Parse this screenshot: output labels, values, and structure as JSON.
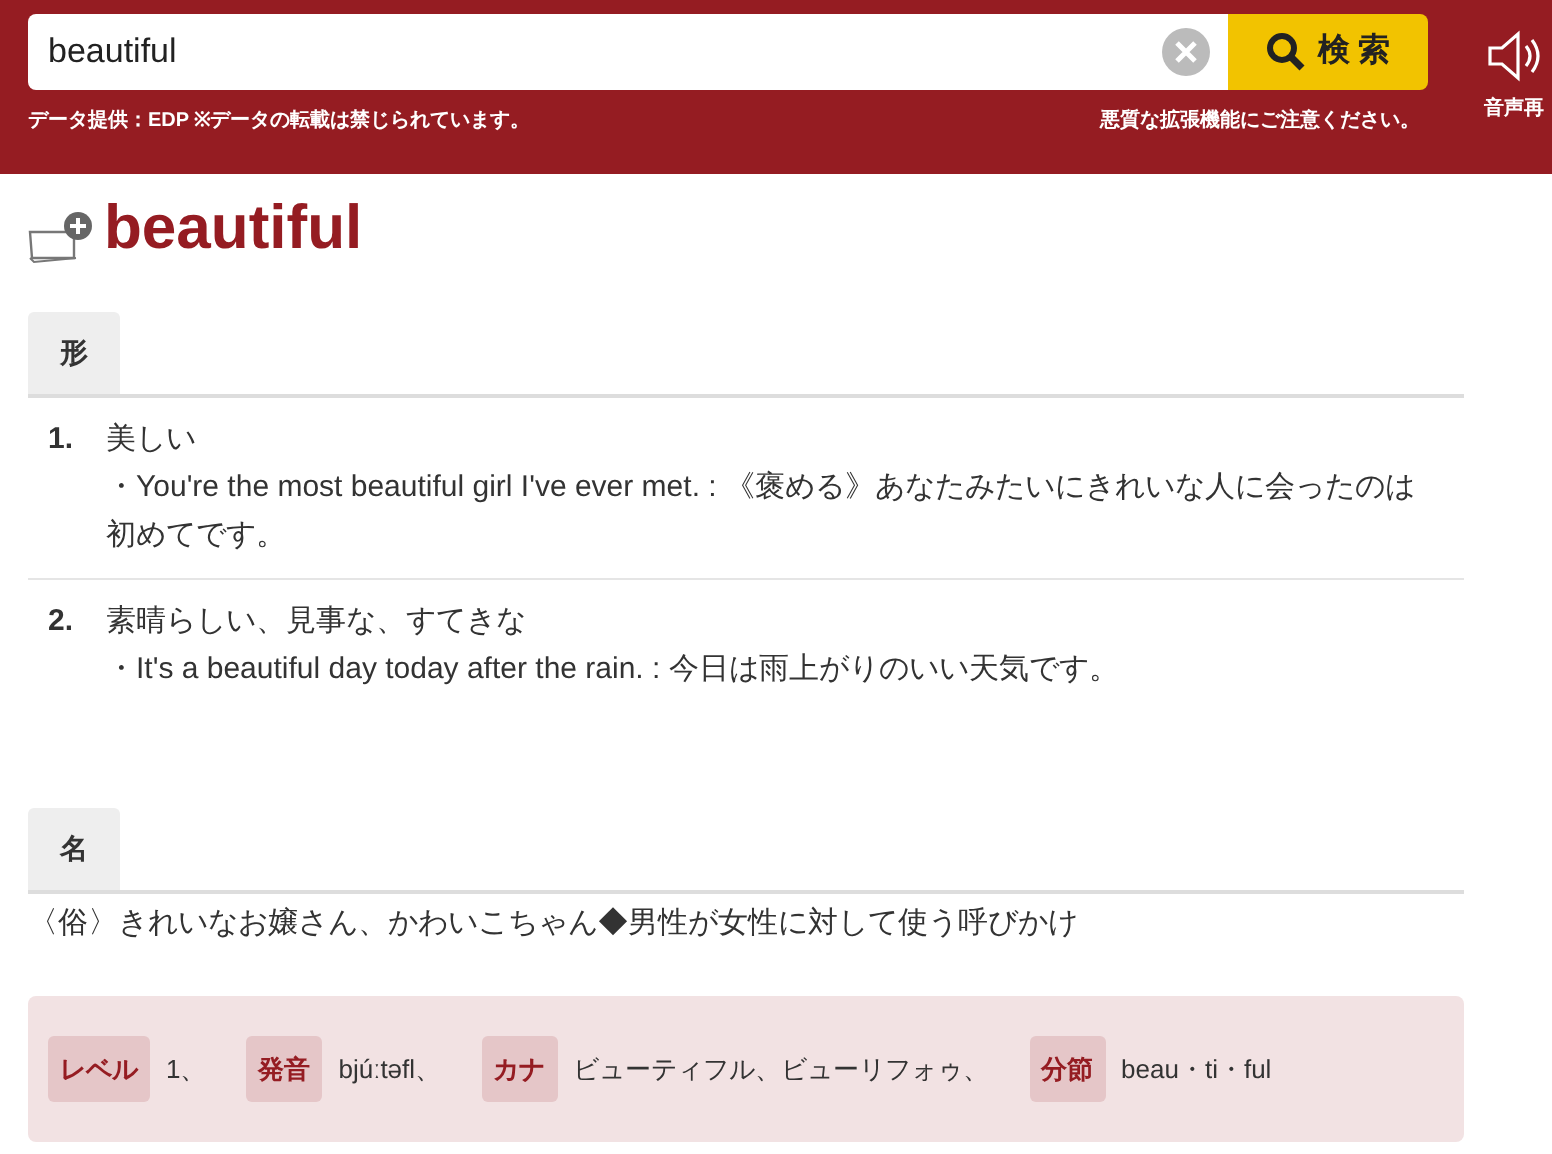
{
  "header": {
    "search": {
      "value": "beautiful",
      "button": "検 索"
    },
    "notices": [
      "データ提供：EDP ※データの転載は禁じられています。",
      "悪質な拡張機能にご注意ください。"
    ],
    "audio_label": "音声再"
  },
  "headword": "beautiful",
  "sections": [
    {
      "pos": "形",
      "kind": "senses",
      "senses": [
        {
          "number": "1.",
          "meaning": "美しい",
          "example": "・You're the most beautiful girl I've ever met. : 《褒める》あなたみたいにきれいな人に会ったのは初めてです。"
        },
        {
          "number": "2.",
          "meaning": "素晴らしい、見事な、すてきな",
          "example": "・It's a beautiful day today after the rain. : 今日は雨上がりのいい天気です。"
        }
      ]
    },
    {
      "pos": "名",
      "kind": "text",
      "text": "〈俗〉きれいなお嬢さん、かわいこちゃん◆男性が女性に対して使う呼びかけ"
    }
  ],
  "info": [
    {
      "label": "レベル",
      "value": "1、"
    },
    {
      "label": "発音",
      "value": "bjúːtəfl、"
    },
    {
      "label": "カナ",
      "value": "ビューティフル、ビューリフォゥ、"
    },
    {
      "label": "分節",
      "value": "beau・ti・ful"
    }
  ]
}
